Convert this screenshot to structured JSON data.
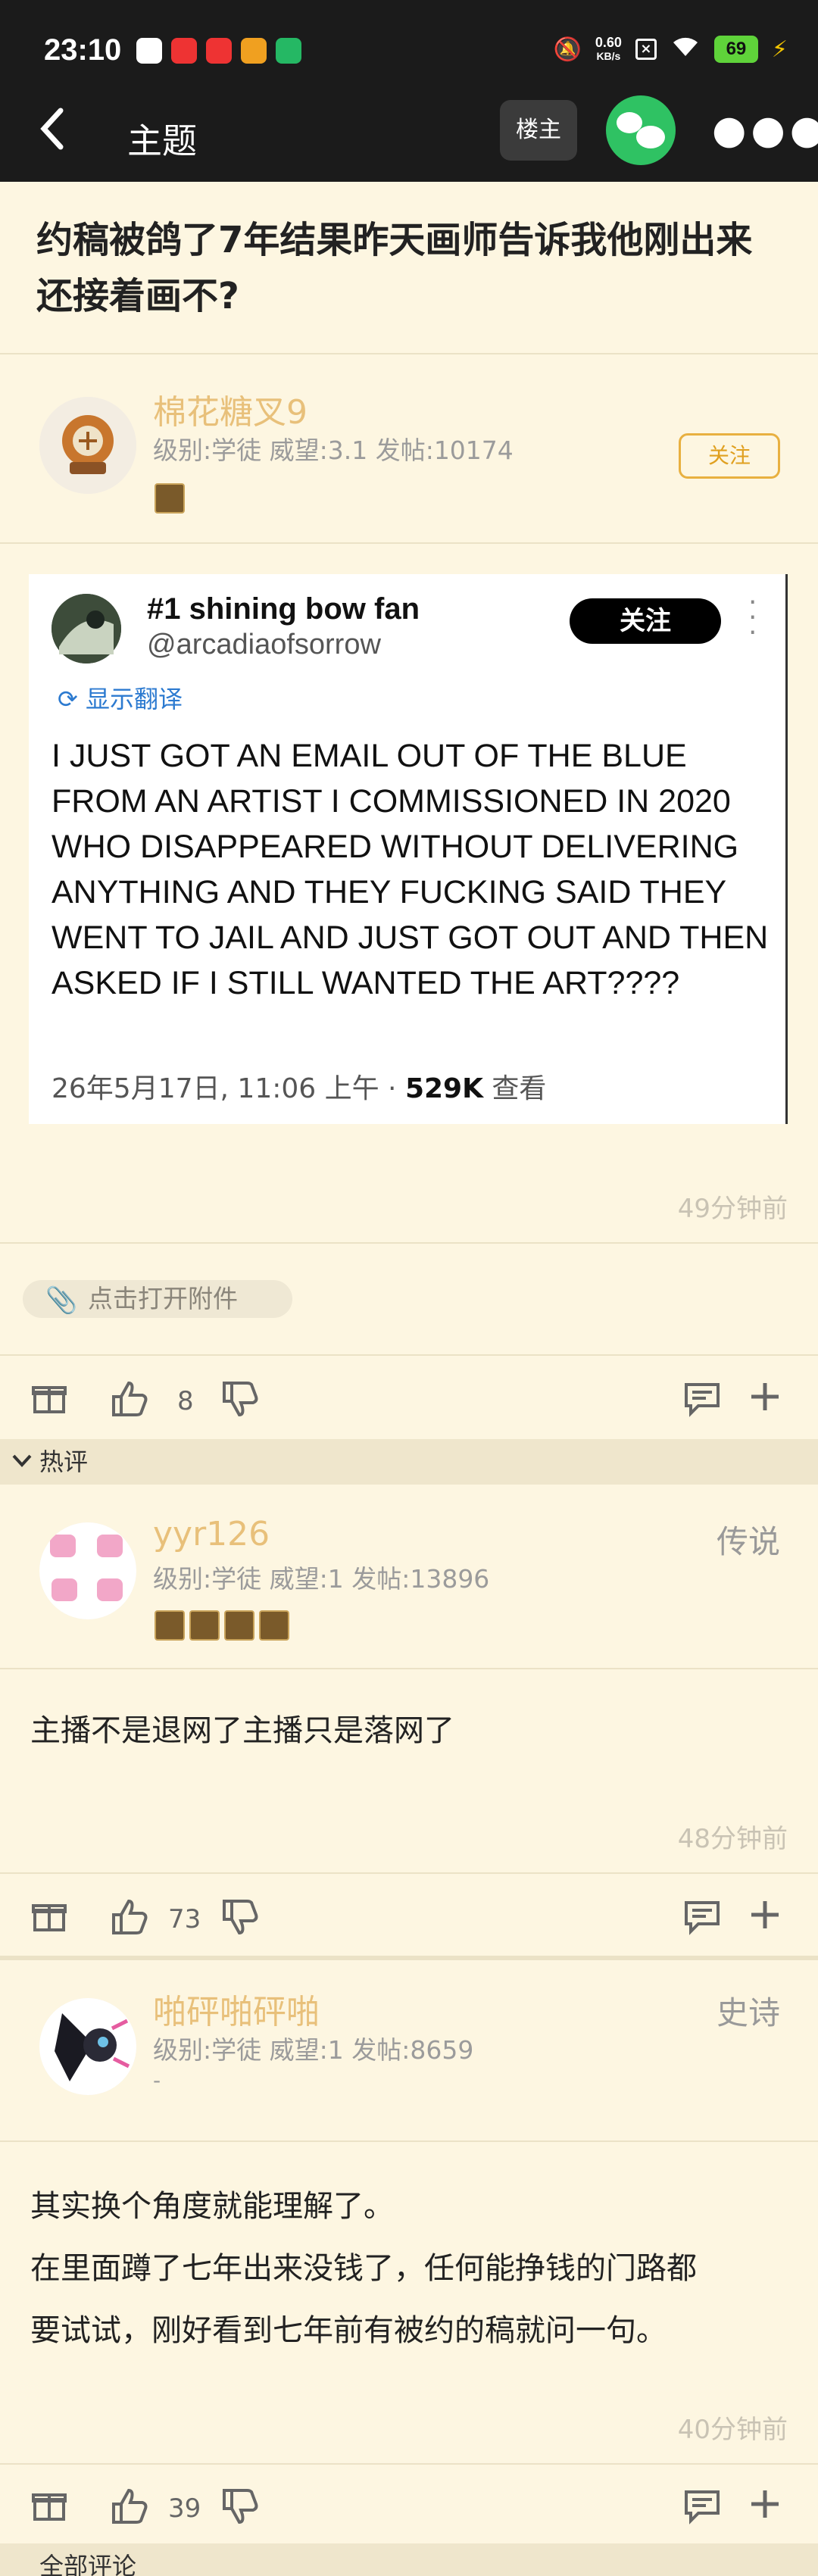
{
  "status_bar": {
    "time": "23:10",
    "net_speed": "0.60",
    "net_unit": "KB/s",
    "battery": "69"
  },
  "nav": {
    "title": "主题",
    "louzhu_label": "楼主"
  },
  "post": {
    "title": "约稿被鸽了7年结果昨天画师告诉我他刚出来还接着画不?",
    "author": {
      "name": "棉花糖叉9",
      "stats": "级别:学徒  威望:3.1  发帖:10174",
      "follow_label": "关注"
    },
    "tweet": {
      "name": "#1 shining bow fan",
      "handle": "@arcadiaofsorrow",
      "follow_label": "关注",
      "translate_label": "显示翻译",
      "body": "I JUST GOT AN EMAIL OUT OF THE BLUE FROM AN ARTIST I COMMISSIONED IN 2020 WHO DISAPPEARED WITHOUT DELIVERING ANYTHING AND THEY FUCKING SAID THEY WENT TO JAIL AND JUST GOT OUT AND THEN ASKED IF I STILL WANTED THE ART????",
      "date": "26年5月17日, 11:06 上午 · ",
      "views": "529K",
      "views_label": " 查看"
    },
    "time_ago": "49分钟前",
    "attachment_label": "点击打开附件",
    "likes": "8"
  },
  "hot_section_label": "热评",
  "comments": [
    {
      "name": "yyr126",
      "stats": "级别:学徒  威望:1  发帖:13896",
      "rank": "传说",
      "text": "主播不是退网了主播只是落网了",
      "time_ago": "48分钟前",
      "likes": "73"
    },
    {
      "name": "啪砰啪砰啪",
      "stats": "级别:学徒  威望:1  发帖:8659",
      "signature": "-",
      "rank": "史诗",
      "text_lines": [
        "其实换个角度就能理解了。",
        "在里面蹲了七年出来没钱了，任何能挣钱的门路都",
        "要试试，刚好看到七年前有被约的稿就问一句。"
      ],
      "time_ago": "40分钟前",
      "likes": "39"
    }
  ],
  "all_comments_label": "全部评论"
}
